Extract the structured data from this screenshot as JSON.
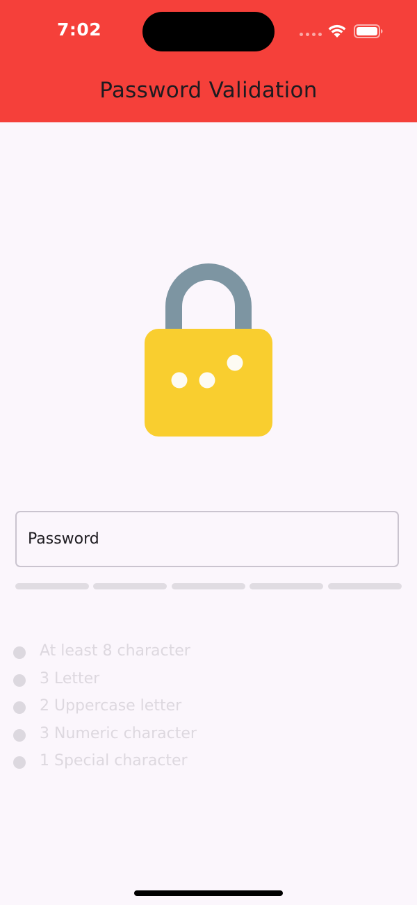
{
  "status_bar": {
    "time": "7:02"
  },
  "header": {
    "title": "Password Validation",
    "background_color": "#f5403a"
  },
  "hero": {
    "icon": "lock-icon",
    "body_color": "#f9ce2f",
    "shackle_color": "#7d95a2"
  },
  "password": {
    "placeholder": "Password",
    "value": ""
  },
  "strength": {
    "segments": 5,
    "filled": 0,
    "empty_color": "#e0dce2"
  },
  "rules": [
    {
      "label": "At least 8 character",
      "met": false
    },
    {
      "label": "3 Letter",
      "met": false
    },
    {
      "label": "2 Uppercase letter",
      "met": false
    },
    {
      "label": "3 Numeric character",
      "met": false
    },
    {
      "label": "1 Special character",
      "met": false
    }
  ]
}
